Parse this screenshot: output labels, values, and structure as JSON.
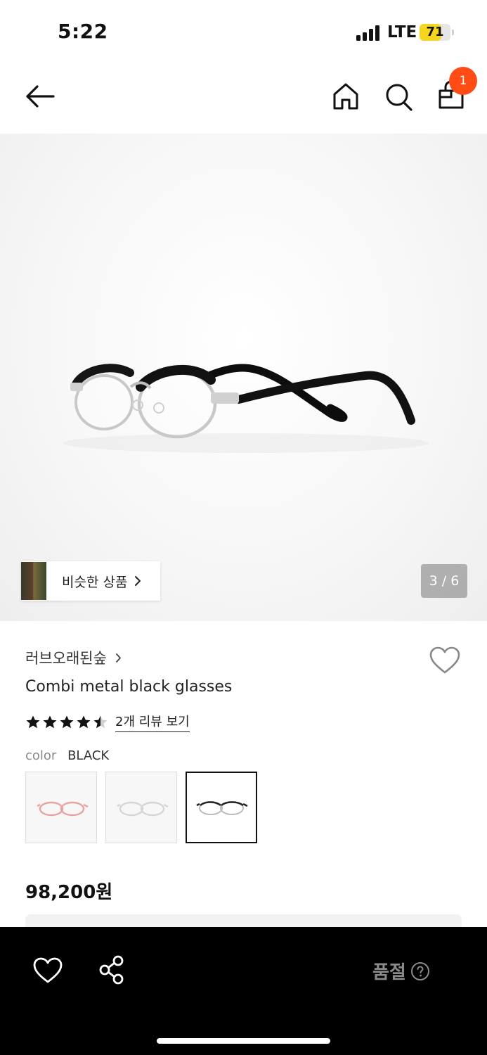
{
  "status_bar": {
    "time": "5:22",
    "network": "LTE",
    "battery_level": "71",
    "battery_fraction": 0.71,
    "battery_color": "#f6d51f"
  },
  "nav": {
    "back_icon": "arrow-left-icon",
    "home_icon": "home-icon",
    "search_icon": "search-icon",
    "cart_icon": "shopping-bag-icon",
    "cart_badge": "1",
    "badge_color": "#ff4b14"
  },
  "gallery": {
    "similar_label": "비슷한 상품",
    "page_indicator": "3 / 6"
  },
  "product": {
    "brand": "러브오래된숲",
    "name": "Combi metal black glasses",
    "rating": 4.5,
    "review_link": "2개 리뷰 보기",
    "color_label": "color",
    "color_value": "BLACK",
    "swatches": [
      {
        "color": "pink"
      },
      {
        "color": "silver"
      },
      {
        "color": "black",
        "selected": true
      }
    ],
    "price": "98,200원"
  },
  "bottom_bar": {
    "wish_icon": "heart-icon",
    "share_icon": "share-icon",
    "status_label": "품절",
    "help_icon": "question-circle-icon"
  }
}
